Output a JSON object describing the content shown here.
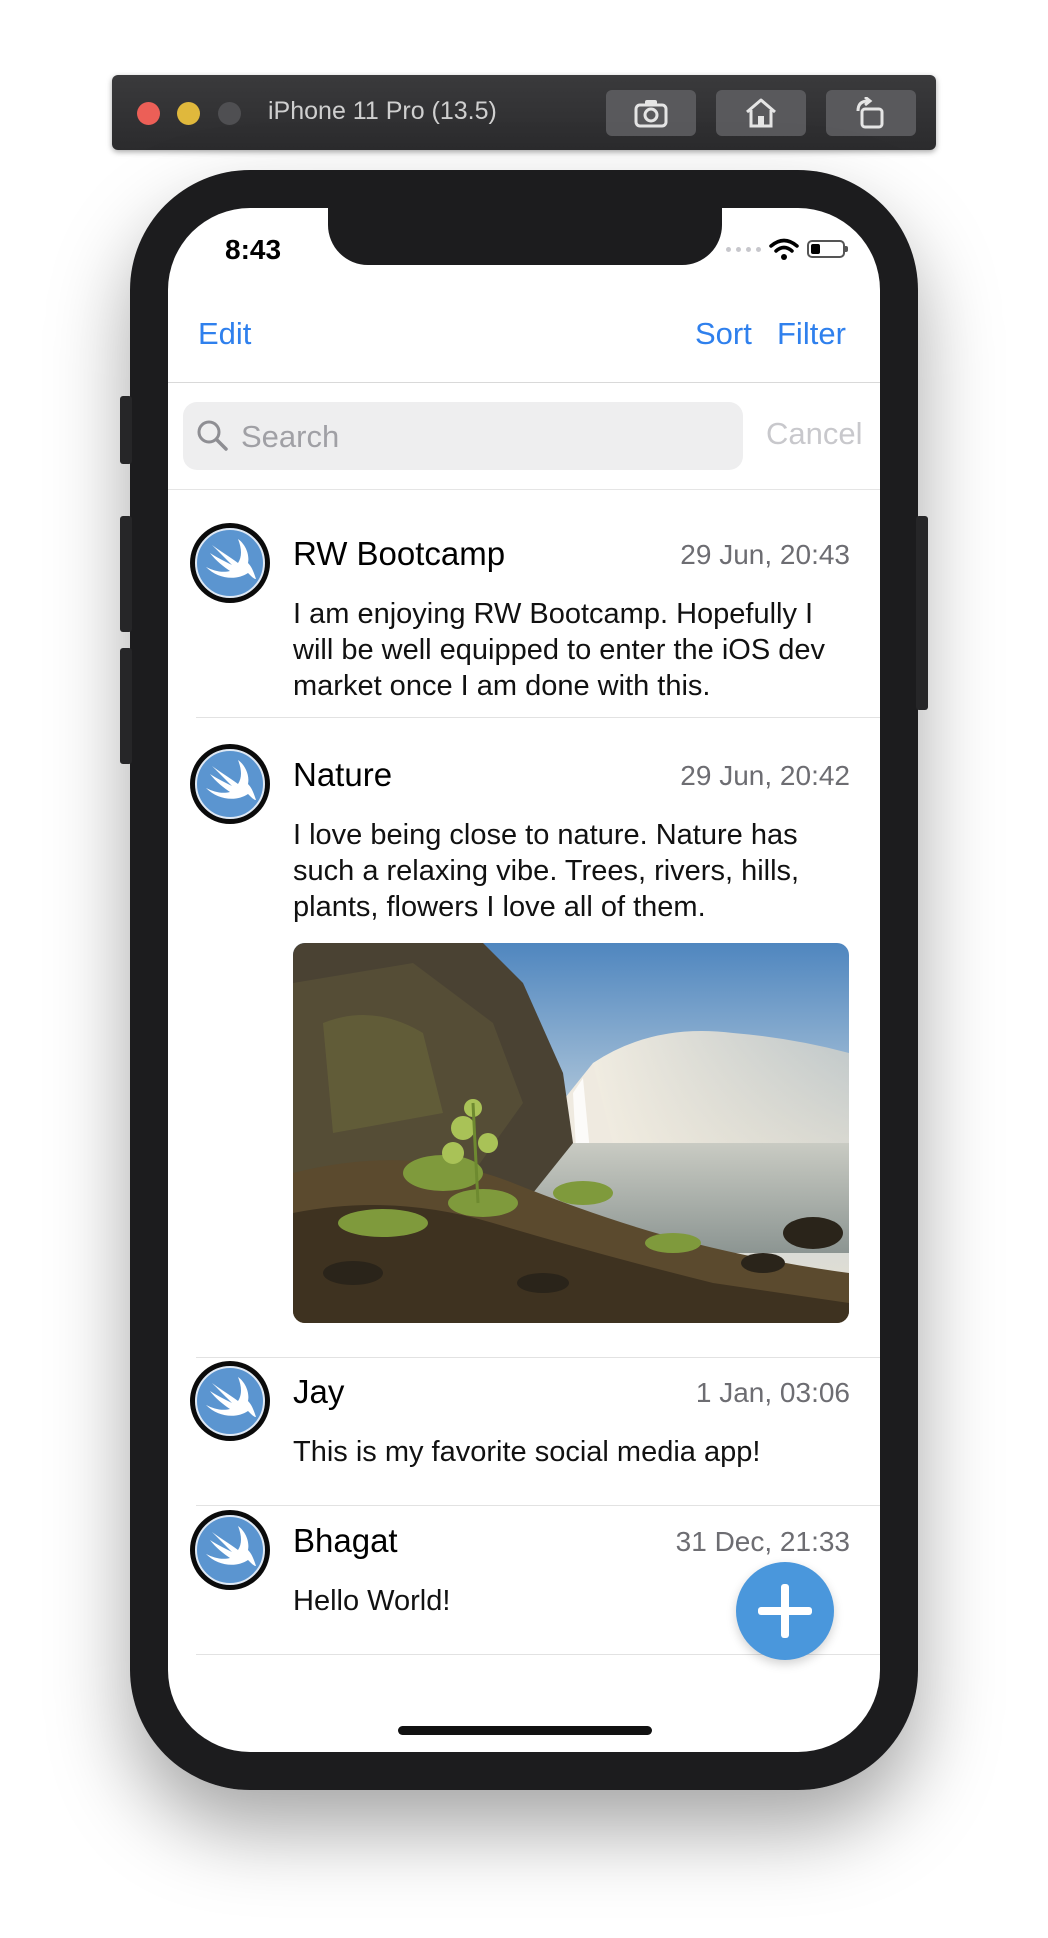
{
  "simulator": {
    "device_title": "iPhone 11 Pro (13.5)",
    "buttons": [
      "camera-icon",
      "home-icon",
      "rotate-icon"
    ]
  },
  "status_bar": {
    "time": "8:43"
  },
  "nav": {
    "edit": "Edit",
    "sort": "Sort",
    "filter": "Filter"
  },
  "search": {
    "placeholder": "Search",
    "cancel": "Cancel"
  },
  "posts": [
    {
      "title": "RW Bootcamp",
      "date": "29 Jun, 20:43",
      "body": "I am enjoying RW Bootcamp. Hopefully I will be well equipped to enter the iOS dev market once I am done with this.",
      "has_image": false
    },
    {
      "title": "Nature",
      "date": "29 Jun, 20:42",
      "body": "I love being close to nature. Nature has such a relaxing vibe. Trees, rivers, hills, plants, flowers I love all of them.",
      "has_image": true
    },
    {
      "title": "Jay",
      "date": "1 Jan, 03:06",
      "body": "This is my favorite social media app!",
      "has_image": false
    },
    {
      "title": "Bhagat",
      "date": "31 Dec, 21:33",
      "body": "Hello World!",
      "has_image": false
    }
  ],
  "colors": {
    "accent": "#2f80ed",
    "fab": "#4a97dc",
    "avatar": "#5b95d0"
  }
}
